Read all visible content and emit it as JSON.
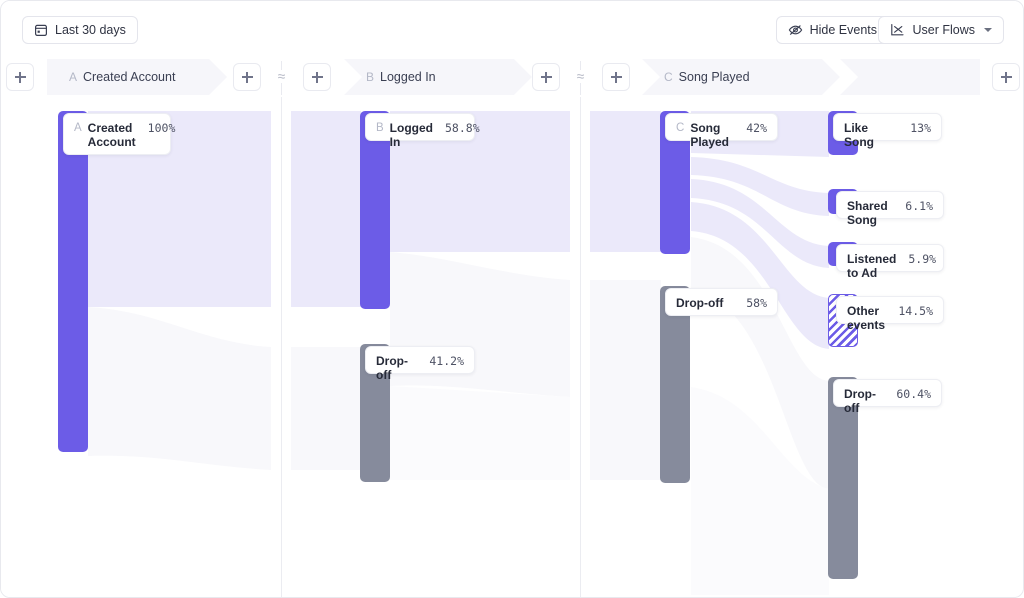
{
  "toolbar": {
    "date_range": {
      "label": "Last 30 days",
      "icon": "calendar-icon"
    },
    "hide_events": {
      "label": "Hide Events",
      "icon": "eye-off-icon"
    },
    "user_flows": {
      "label": "User Flows",
      "icon": "flow-icon",
      "caret": "chevron-down-icon"
    }
  },
  "header": {
    "add_label": "+",
    "divider_glyph": "≈",
    "steps": [
      {
        "key": "A",
        "label": "Created Account"
      },
      {
        "key": "B",
        "label": "Logged In"
      },
      {
        "key": "C",
        "label": "Song Played"
      }
    ]
  },
  "colors": {
    "accent": "#6c5ce7",
    "dropoff": "#868b9c",
    "ribbon": "#ebe9fa",
    "ribbon_dropoff": "#f7f7fa",
    "chip_bg": "#f6f6fa"
  },
  "chart_data": {
    "type": "sankey",
    "title": "User Flows",
    "date_range": "Last 30 days",
    "columns": [
      {
        "step_key": "A",
        "step_label": "Created Account",
        "nodes": [
          {
            "key": "A",
            "name": "Created\nAccount",
            "value": "100%",
            "pct": 100,
            "kind": "event"
          }
        ]
      },
      {
        "step_key": "B",
        "step_label": "Logged In",
        "nodes": [
          {
            "key": "B",
            "name": "Logged In",
            "value": "58.8%",
            "pct": 58.8,
            "kind": "event"
          },
          {
            "key": "",
            "name": "Drop-off",
            "value": "41.2%",
            "pct": 41.2,
            "kind": "dropoff"
          }
        ]
      },
      {
        "step_key": "C",
        "step_label": "Song Played",
        "nodes": [
          {
            "key": "C",
            "name": "Song Played",
            "value": "42%",
            "pct": 42,
            "kind": "event"
          },
          {
            "key": "",
            "name": "Drop-off",
            "value": "58%",
            "pct": 58,
            "kind": "dropoff"
          }
        ]
      },
      {
        "step_key": "",
        "step_label": "",
        "nodes": [
          {
            "key": "",
            "name": "Like Song",
            "value": "13%",
            "pct": 13,
            "kind": "event"
          },
          {
            "key": "",
            "name": "Shared Song",
            "value": "6.1%",
            "pct": 6.1,
            "kind": "event"
          },
          {
            "key": "",
            "name": "Listened to Ad",
            "value": "5.9%",
            "pct": 5.9,
            "kind": "event"
          },
          {
            "key": "",
            "name": "Other events",
            "value": "14.5%",
            "pct": 14.5,
            "kind": "other"
          },
          {
            "key": "",
            "name": "Drop-off",
            "value": "60.4%",
            "pct": 60.4,
            "kind": "dropoff"
          }
        ]
      }
    ],
    "links": [
      {
        "from": "Created Account",
        "to": "Logged In",
        "pct": 58.8
      },
      {
        "from": "Created Account",
        "to": "Drop-off (B)",
        "pct": 41.2
      },
      {
        "from": "Logged In",
        "to": "Song Played",
        "pct": 42
      },
      {
        "from": "Logged In",
        "to": "Drop-off (C)",
        "pct": 58
      },
      {
        "from": "Song Played",
        "to": "Like Song",
        "pct": 13
      },
      {
        "from": "Song Played",
        "to": "Shared Song",
        "pct": 6.1
      },
      {
        "from": "Song Played",
        "to": "Listened to Ad",
        "pct": 5.9
      },
      {
        "from": "Song Played",
        "to": "Other events",
        "pct": 14.5
      },
      {
        "from": "Song Played",
        "to": "Drop-off (final)",
        "pct": 60.4
      }
    ]
  }
}
